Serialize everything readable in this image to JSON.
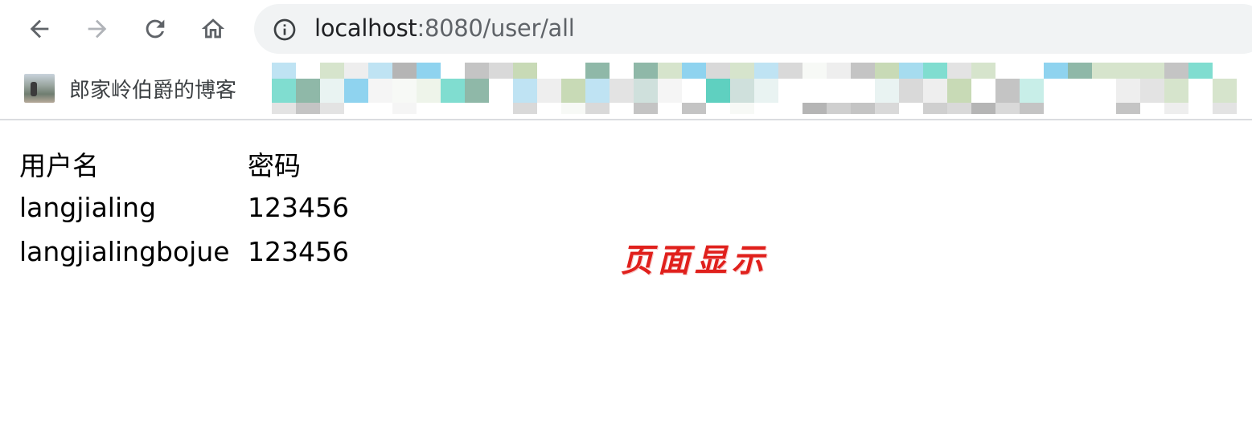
{
  "browser": {
    "address_bar": {
      "url_host": "localhost",
      "url_rest": ":8080/user/all"
    },
    "bookmarks": [
      {
        "label": "郎家岭伯爵的博客"
      }
    ],
    "icons": {
      "back": "arrow-left-icon",
      "forward": "arrow-right-icon",
      "reload": "reload-icon",
      "home": "home-icon",
      "site_info": "info-icon"
    },
    "colors": {
      "icon": "#5f6368",
      "icon_disabled": "#b0b3b8",
      "omnibox_bg": "#f1f3f4"
    }
  },
  "page": {
    "table": {
      "headers": [
        "用户名",
        "密码"
      ],
      "rows": [
        [
          "langjialing",
          "123456"
        ],
        [
          "langjialingbojue",
          "123456"
        ]
      ]
    },
    "annotation": "页面显示",
    "annotation_color": "#e0201c"
  }
}
